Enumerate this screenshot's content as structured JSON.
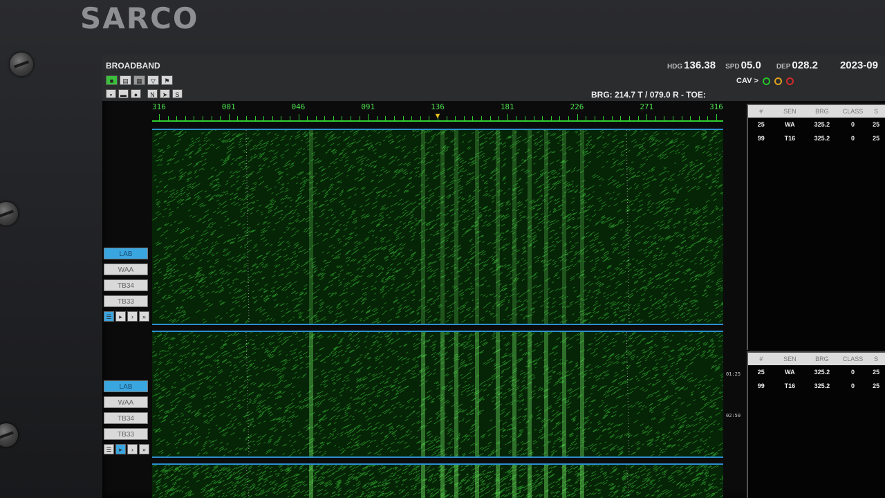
{
  "brand": "SARCO",
  "topbar": {
    "mode": "BROADBAND",
    "hdg_label": "HDG",
    "hdg_value": "136.38",
    "spd_label": "SPD",
    "spd_value": "05.0",
    "dep_label": "DEP",
    "dep_value": "028.2",
    "datetime": "2023-09",
    "cav_label": "CAV >",
    "cav_colors": [
      "#27c427",
      "#e0a21c",
      "#d42a2a"
    ],
    "brg_readout": "BRG: 214.7 T / 079.0 R - TOE:",
    "toolbar_row1": [
      "display-icon",
      "window-icon",
      "panel-icon",
      "filter-icon",
      "marker-icon"
    ],
    "toolbar_row2": [
      "stop-icon",
      "pause-icon",
      "record-icon"
    ],
    "toolbar_row2_text": [
      "N",
      "S"
    ]
  },
  "bearing_axis": {
    "labels": [
      "316",
      "001",
      "046",
      "091",
      "136",
      "181",
      "226",
      "271",
      "316"
    ],
    "marker_glyph": "▼"
  },
  "waterfalls": [
    {
      "sensor_buttons": [
        "LAB",
        "WAA",
        "TB34",
        "TB33"
      ],
      "active_sensor": "LAB",
      "playback": [
        "☰",
        "▸",
        "›",
        "»"
      ],
      "active_playback": "☰"
    },
    {
      "sensor_buttons": [
        "LAB",
        "WAA",
        "TB34",
        "TB33"
      ],
      "active_sensor": "LAB",
      "playback": [
        "☰",
        "▸",
        "›",
        "»"
      ],
      "active_playback": "▸",
      "time_marks": [
        "01:25",
        "02:50"
      ]
    }
  ],
  "contact_tables": [
    {
      "headers": [
        "#",
        "SEN",
        "BRG",
        "CLASS",
        "S"
      ],
      "rows": [
        [
          "25",
          "WA",
          "325.2",
          "0",
          "25"
        ],
        [
          "99",
          "T16",
          "325.2",
          "0",
          "25"
        ]
      ]
    },
    {
      "headers": [
        "#",
        "SEN",
        "BRG",
        "CLASS",
        "S"
      ],
      "rows": [
        [
          "25",
          "WA",
          "325.2",
          "0",
          "25"
        ],
        [
          "99",
          "T16",
          "325.2",
          "0",
          "25"
        ]
      ]
    }
  ],
  "colors": {
    "trace": "#2fd02f",
    "accent": "#3aa6e0",
    "marker": "#e8c31c"
  }
}
